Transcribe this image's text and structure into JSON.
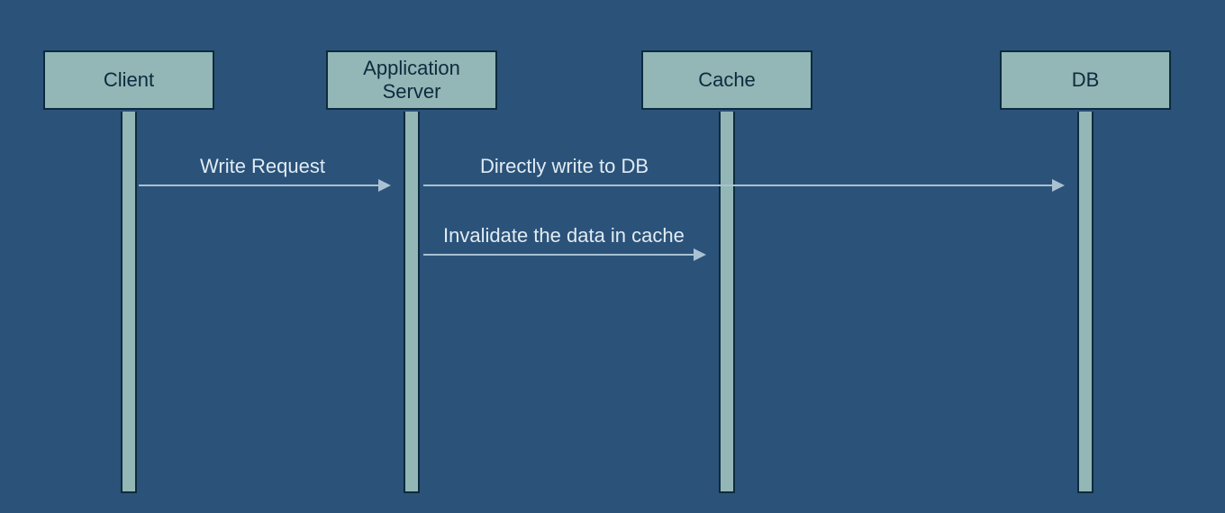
{
  "actors": {
    "client": {
      "label": "Client"
    },
    "appserver": {
      "label": "Application\nServer"
    },
    "cache": {
      "label": "Cache"
    },
    "db": {
      "label": "DB"
    }
  },
  "messages": {
    "m1": {
      "label": "Write Request"
    },
    "m2": {
      "label": "Directly write to DB"
    },
    "m3": {
      "label": "Invalidate the data in cache"
    }
  },
  "colors": {
    "background": "#2b5279",
    "boxFill": "#93b6b6",
    "boxStroke": "#0d2b3e",
    "arrow": "#a9c1d3",
    "labelText": "#e0ecf4"
  }
}
